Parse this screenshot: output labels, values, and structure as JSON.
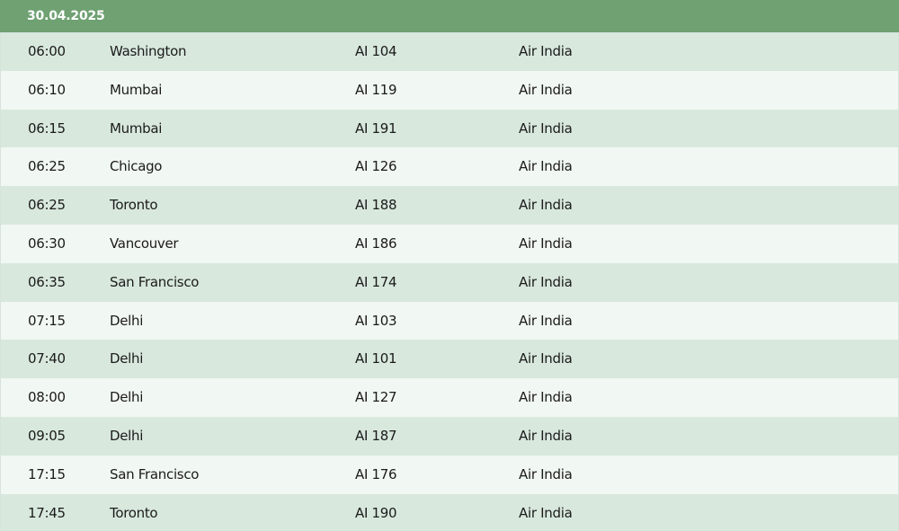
{
  "board": {
    "date": "30.04.2025",
    "flights": [
      {
        "time": "06:00",
        "destination": "Washington",
        "flight": "AI 104",
        "airline": "Air India"
      },
      {
        "time": "06:10",
        "destination": "Mumbai",
        "flight": "AI 119",
        "airline": "Air India"
      },
      {
        "time": "06:15",
        "destination": "Mumbai",
        "flight": "AI 191",
        "airline": "Air India"
      },
      {
        "time": "06:25",
        "destination": "Chicago",
        "flight": "AI 126",
        "airline": "Air India"
      },
      {
        "time": "06:25",
        "destination": "Toronto",
        "flight": "AI 188",
        "airline": "Air India"
      },
      {
        "time": "06:30",
        "destination": "Vancouver",
        "flight": "AI 186",
        "airline": "Air India"
      },
      {
        "time": "06:35",
        "destination": "San Francisco",
        "flight": "AI 174",
        "airline": "Air India"
      },
      {
        "time": "07:15",
        "destination": "Delhi",
        "flight": "AI 103",
        "airline": "Air India"
      },
      {
        "time": "07:40",
        "destination": "Delhi",
        "flight": "AI 101",
        "airline": "Air India"
      },
      {
        "time": "08:00",
        "destination": "Delhi",
        "flight": "AI 127",
        "airline": "Air India"
      },
      {
        "time": "09:05",
        "destination": "Delhi",
        "flight": "AI 187",
        "airline": "Air India"
      },
      {
        "time": "17:15",
        "destination": "San Francisco",
        "flight": "AI 176",
        "airline": "Air India"
      },
      {
        "time": "17:45",
        "destination": "Toronto",
        "flight": "AI 190",
        "airline": "Air India"
      }
    ]
  },
  "colors": {
    "header_bg": "#6fa173",
    "row_odd": "#d8e8dd",
    "row_even": "#f1f7f3"
  }
}
